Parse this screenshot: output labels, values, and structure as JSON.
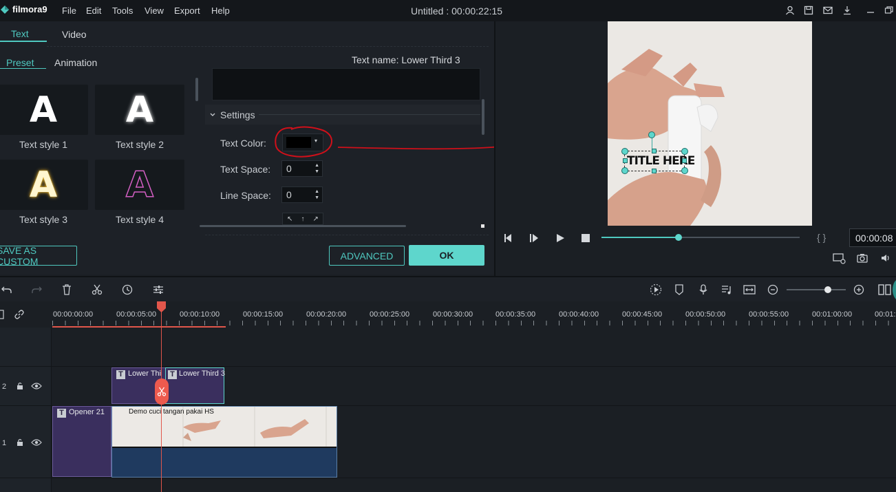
{
  "app": {
    "logo_text": "filmora9",
    "window_title": "Untitled : 00:00:22:15",
    "menu": [
      "File",
      "Edit",
      "Tools",
      "View",
      "Export",
      "Help"
    ]
  },
  "editor": {
    "tabs": [
      "Text",
      "Video"
    ],
    "subtabs": [
      "Preset",
      "Animation"
    ],
    "text_name": "Text name: Lower Third 3",
    "settings_label": "Settings",
    "text_color_label": "Text Color:",
    "text_space_label": "Text Space:",
    "text_space_value": "0",
    "line_space_label": "Line Space:",
    "line_space_value": "0",
    "presets": [
      {
        "glyph": "A",
        "label": "Text style 1"
      },
      {
        "glyph": "A",
        "label": "Text style 2"
      },
      {
        "glyph": "A",
        "label": "Text style 3"
      },
      {
        "glyph": "A",
        "label": "Text style 4"
      }
    ],
    "save_custom": "SAVE AS CUSTOM",
    "advanced": "ADVANCED",
    "ok": "OK",
    "colors": {
      "accent": "#4fc9c0",
      "ok_bg": "#5ed6cc",
      "annotation": "#d0101a"
    }
  },
  "preview": {
    "overlay_text": "TITLE HERE",
    "timecode": "00:00:08",
    "progress_fraction": 0.39
  },
  "timeline": {
    "ruler": [
      "00:00:00:00",
      "00:00:05:00",
      "00:00:10:00",
      "00:00:15:00",
      "00:00:20:00",
      "00:00:25:00",
      "00:00:30:00",
      "00:00:35:00",
      "00:00:40:00",
      "00:00:45:00",
      "00:00:50:00",
      "00:00:55:00",
      "00:01:00:00",
      "00:01:0"
    ],
    "tracks": [
      {
        "num": "2",
        "clips": [
          "Lower Thi",
          "Lower Third 3"
        ]
      },
      {
        "num": "1",
        "clips": [
          "Opener 21",
          "Demo cuci tangan pakai HS"
        ]
      }
    ],
    "zoom_fraction": 0.7
  }
}
